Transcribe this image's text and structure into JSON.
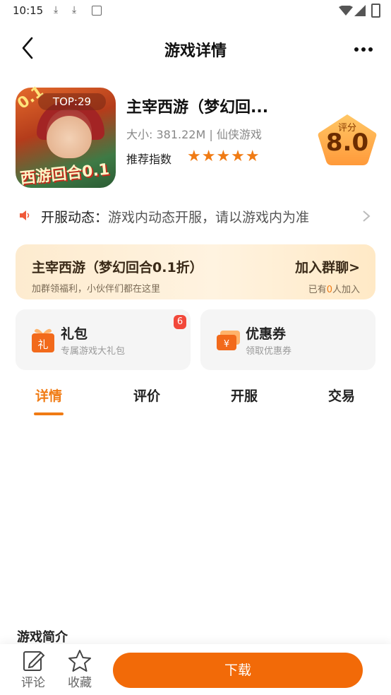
{
  "status_bar": {
    "time": "10:15"
  },
  "header": {
    "title": "游戏详情"
  },
  "game": {
    "name": "主宰西游（梦幻回...",
    "icon_tag": "TOP:29",
    "icon_brand": "西游回合0.1",
    "icon_corner": "0.1",
    "size_line": "大小: 381.22M | 仙侠游戏",
    "recommend_label": "推荐指数",
    "stars": "★★★★★",
    "rating_label": "评分",
    "rating": "8.0"
  },
  "server_notice": {
    "label": "开服动态：",
    "value": "游戏内动态开服，请以游戏内为准"
  },
  "group_banner": {
    "title": "主宰西游（梦幻回合0.1折）",
    "subtitle": "加群领福利，小伙伴们都在这里",
    "join_label": "加入群聊>",
    "count_prefix": "已有",
    "count": "0",
    "count_suffix": "人加入"
  },
  "cards": [
    {
      "title": "礼包",
      "subtitle": "专属游戏大礼包",
      "badge": "6",
      "icon_glyph": "礼"
    },
    {
      "title": "优惠券",
      "subtitle": "领取优惠券",
      "icon_glyph": "¥"
    }
  ],
  "tabs": [
    {
      "label": "详情",
      "active": true
    },
    {
      "label": "评价"
    },
    {
      "label": "开服"
    },
    {
      "label": "交易"
    }
  ],
  "intro_title": "游戏简介",
  "bottom": {
    "comment_label": "评论",
    "favorite_label": "收藏",
    "download_label": "下载"
  },
  "colors": {
    "accent": "#f07b14",
    "download": "#f26a08",
    "badge": "#f2483a"
  }
}
